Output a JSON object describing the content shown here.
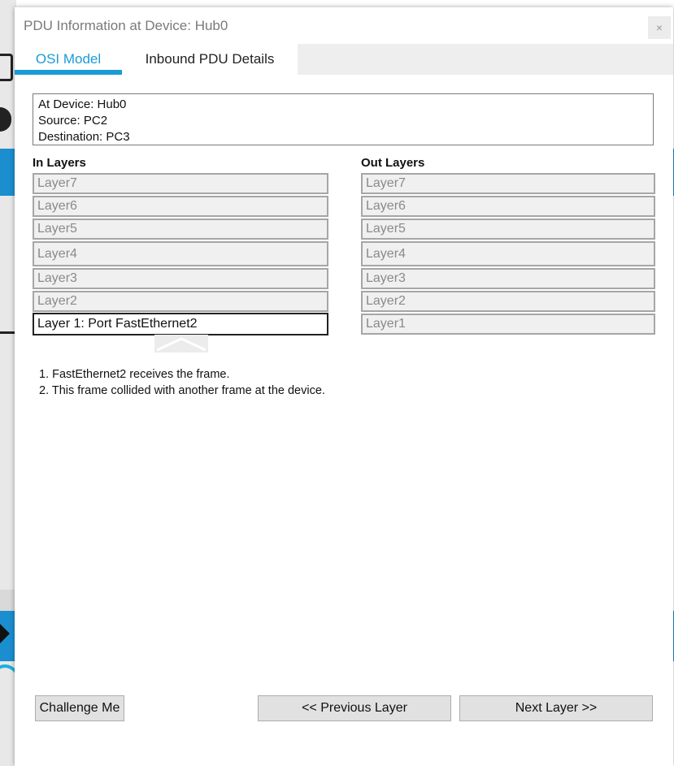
{
  "dialog": {
    "title": "PDU Information at Device: Hub0",
    "close_glyph": "×"
  },
  "tabs": [
    {
      "label": "OSI Model",
      "active": true
    },
    {
      "label": "Inbound PDU Details",
      "active": false
    }
  ],
  "info": {
    "device": "At Device: Hub0",
    "source": "Source: PC2",
    "destination": "Destination: PC3"
  },
  "in_layers": {
    "heading": "In Layers",
    "items": [
      "Layer7",
      "Layer6",
      "Layer5",
      "Layer4",
      "Layer3",
      "Layer2",
      "Layer 1: Port FastEthernet2"
    ]
  },
  "out_layers": {
    "heading": "Out Layers",
    "items": [
      "Layer7",
      "Layer6",
      "Layer5",
      "Layer4",
      "Layer3",
      "Layer2",
      "Layer1"
    ]
  },
  "steps": [
    "1. FastEthernet2 receives the frame.",
    "2. This frame collided with another frame at the device."
  ],
  "buttons": {
    "challenge": "Challenge Me",
    "previous": "<< Previous Layer",
    "next": "Next Layer >>"
  },
  "colors": {
    "accent": "#1a9bd7",
    "background_app_blue": "#1a8ecf"
  },
  "icons": {
    "close": "close-icon",
    "collapse": "chevron-up-icon"
  }
}
